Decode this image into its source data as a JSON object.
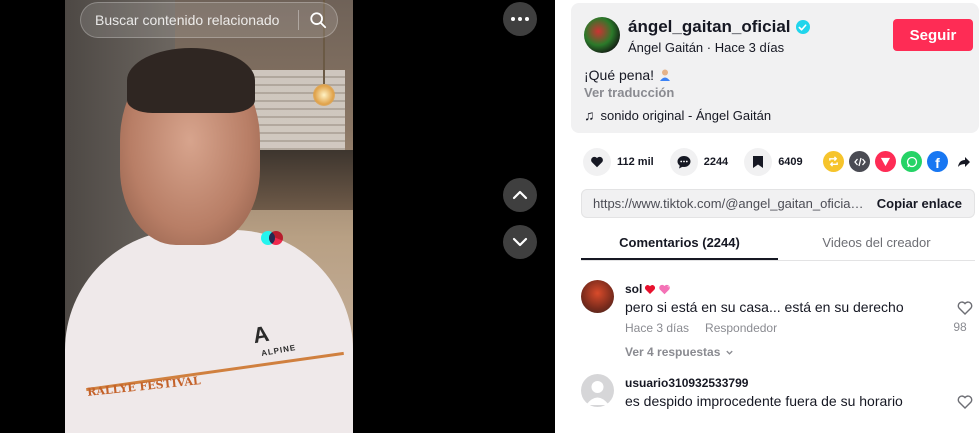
{
  "search": {
    "placeholder": "Buscar contenido relacionado"
  },
  "video": {
    "shirt_text": "RALLYE FESTIVAL",
    "brand": "A",
    "brand_sub": "ALPINE"
  },
  "post": {
    "username": "ángel_gaitan_oficial",
    "display_line": "Ángel Gaitán · Hace 3 días",
    "follow_label": "Seguir",
    "caption": "¡Qué pena!",
    "translate": "Ver traducción",
    "sound": "sonido original - Ángel Gaitán"
  },
  "actions": {
    "likes": "112 mil",
    "comments": "2244",
    "saves": "6409"
  },
  "share_colors": {
    "repost": "#f6c42c",
    "embed": "#4a4b53",
    "send": "#fe2c55",
    "whatsapp": "#25d366",
    "facebook": "#1877f2"
  },
  "link": {
    "url": "https://www.tiktok.com/@angel_gaitan_oficial/vid...",
    "copy_label": "Copiar enlace"
  },
  "tabs": {
    "comments": "Comentarios (2244)",
    "creator_videos": "Videos del creador"
  },
  "comments": [
    {
      "user": "sol",
      "text": "pero si está en su casa... está en su derecho",
      "time": "Hace 3 días",
      "reply": "Respondedor",
      "likes": "98",
      "replies": "Ver 4 respuestas"
    },
    {
      "user": "usuario310932533799",
      "text": "es despido improcedente fuera de su horario"
    }
  ]
}
